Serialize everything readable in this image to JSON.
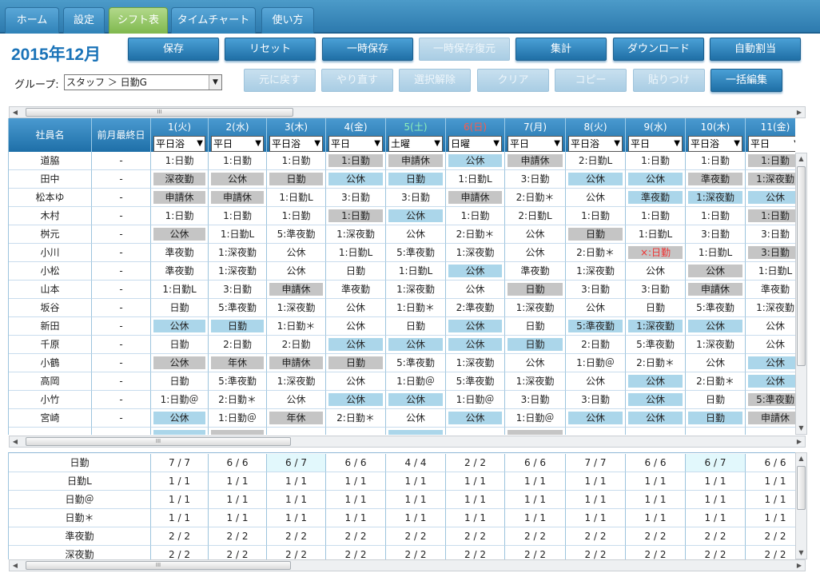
{
  "tabs": [
    {
      "label": "ホーム"
    },
    {
      "label": "設定"
    },
    {
      "label": "シフト表",
      "active": true
    },
    {
      "label": "タイムチャート"
    },
    {
      "label": "使い方"
    }
  ],
  "month_title": "2015年12月",
  "toolbar_row1": [
    {
      "label": "保存",
      "enabled": true
    },
    {
      "label": "リセット",
      "enabled": true
    },
    {
      "label": "一時保存",
      "enabled": true
    },
    {
      "label": "一時保存復元",
      "enabled": false
    },
    {
      "label": "集計",
      "enabled": true
    },
    {
      "label": "ダウンロード",
      "enabled": true
    },
    {
      "label": "自動割当",
      "enabled": true
    }
  ],
  "toolbar_row2": [
    {
      "label": "元に戻す",
      "enabled": false
    },
    {
      "label": "やり直す",
      "enabled": false
    },
    {
      "label": "選択解除",
      "enabled": false
    },
    {
      "label": "クリア",
      "enabled": false
    },
    {
      "label": "コピー",
      "enabled": false
    },
    {
      "label": "貼りつけ",
      "enabled": false
    },
    {
      "label": "一括編集",
      "enabled": true
    }
  ],
  "group": {
    "label": "グループ:",
    "value": "スタッフ ＞ 日勤G"
  },
  "headers": {
    "name": "社員名",
    "last": "前月最終日"
  },
  "days": [
    {
      "label": "1(火)",
      "sel": "平日浴"
    },
    {
      "label": "2(水)",
      "sel": "平日"
    },
    {
      "label": "3(木)",
      "sel": "平日浴"
    },
    {
      "label": "4(金)",
      "sel": "平日"
    },
    {
      "label": "5(土)",
      "sel": "土曜",
      "kind": "sat"
    },
    {
      "label": "6(日)",
      "sel": "日曜",
      "kind": "sun"
    },
    {
      "label": "7(月)",
      "sel": "平日"
    },
    {
      "label": "8(火)",
      "sel": "平日浴"
    },
    {
      "label": "9(水)",
      "sel": "平日"
    },
    {
      "label": "10(木)",
      "sel": "平日浴"
    },
    {
      "label": "11(金)",
      "sel": "平日"
    }
  ],
  "colors": {
    "blue": "#abd6ea",
    "gray": "#c5c5c5",
    "accent": "#1a73b8"
  },
  "staff": [
    {
      "name": "道脇",
      "last": "-",
      "cells": [
        [
          "1:日勤",
          ""
        ],
        [
          "1:日勤",
          ""
        ],
        [
          "1:日勤",
          ""
        ],
        [
          "1:日勤",
          "g"
        ],
        [
          "申請休",
          "g"
        ],
        [
          "公休",
          "b"
        ],
        [
          "申請休",
          "g"
        ],
        [
          "2:日勤L",
          ""
        ],
        [
          "1:日勤",
          ""
        ],
        [
          "1:日勤",
          ""
        ],
        [
          "1:日勤",
          "g"
        ]
      ]
    },
    {
      "name": "田中",
      "last": "-",
      "cells": [
        [
          "深夜勤",
          "g"
        ],
        [
          "公休",
          "g"
        ],
        [
          "日勤",
          "g"
        ],
        [
          "公休",
          "b"
        ],
        [
          "日勤",
          "b"
        ],
        [
          "1:日勤L",
          ""
        ],
        [
          "3:日勤",
          ""
        ],
        [
          "公休",
          "b"
        ],
        [
          "公休",
          "b"
        ],
        [
          "準夜勤",
          "g"
        ],
        [
          "1:深夜勤",
          "g"
        ]
      ]
    },
    {
      "name": "松本ゆ",
      "last": "-",
      "cells": [
        [
          "申請休",
          "g"
        ],
        [
          "申請休",
          "g"
        ],
        [
          "1:日勤L",
          ""
        ],
        [
          "3:日勤",
          ""
        ],
        [
          "3:日勤",
          ""
        ],
        [
          "申請休",
          "g"
        ],
        [
          "2:日勤＊",
          ""
        ],
        [
          "公休",
          ""
        ],
        [
          "準夜勤",
          "b"
        ],
        [
          "1:深夜勤",
          "b"
        ],
        [
          "公休",
          "b"
        ]
      ]
    },
    {
      "name": "木村",
      "last": "-",
      "cells": [
        [
          "1:日勤",
          ""
        ],
        [
          "1:日勤",
          ""
        ],
        [
          "1:日勤",
          ""
        ],
        [
          "1:日勤",
          "g"
        ],
        [
          "公休",
          "b"
        ],
        [
          "1:日勤",
          ""
        ],
        [
          "2:日勤L",
          ""
        ],
        [
          "1:日勤",
          ""
        ],
        [
          "1:日勤",
          ""
        ],
        [
          "1:日勤",
          ""
        ],
        [
          "1:日勤",
          "g"
        ]
      ]
    },
    {
      "name": "桝元",
      "last": "-",
      "cells": [
        [
          "公休",
          "g"
        ],
        [
          "1:日勤L",
          ""
        ],
        [
          "5:準夜勤",
          ""
        ],
        [
          "1:深夜勤",
          ""
        ],
        [
          "公休",
          ""
        ],
        [
          "2:日勤＊",
          ""
        ],
        [
          "公休",
          ""
        ],
        [
          "日勤",
          "g"
        ],
        [
          "1:日勤L",
          ""
        ],
        [
          "3:日勤",
          ""
        ],
        [
          "3:日勤",
          ""
        ]
      ]
    },
    {
      "name": "小川",
      "last": "-",
      "cells": [
        [
          "準夜勤",
          ""
        ],
        [
          "1:深夜勤",
          ""
        ],
        [
          "公休",
          ""
        ],
        [
          "1:日勤L",
          ""
        ],
        [
          "5:準夜勤",
          ""
        ],
        [
          "1:深夜勤",
          ""
        ],
        [
          "公休",
          ""
        ],
        [
          "2:日勤＊",
          ""
        ],
        [
          "×:日勤",
          "g",
          "red"
        ],
        [
          "1:日勤L",
          ""
        ],
        [
          "3:日勤",
          "g"
        ]
      ]
    },
    {
      "name": "小松",
      "last": "-",
      "cells": [
        [
          "準夜勤",
          ""
        ],
        [
          "1:深夜勤",
          ""
        ],
        [
          "公休",
          ""
        ],
        [
          "日勤",
          ""
        ],
        [
          "1:日勤L",
          ""
        ],
        [
          "公休",
          "b"
        ],
        [
          "準夜勤",
          ""
        ],
        [
          "1:深夜勤",
          ""
        ],
        [
          "公休",
          ""
        ],
        [
          "公休",
          "g"
        ],
        [
          "1:日勤L",
          ""
        ]
      ]
    },
    {
      "name": "山本",
      "last": "-",
      "cells": [
        [
          "1:日勤L",
          ""
        ],
        [
          "3:日勤",
          ""
        ],
        [
          "申請休",
          "g"
        ],
        [
          "準夜勤",
          ""
        ],
        [
          "1:深夜勤",
          ""
        ],
        [
          "公休",
          ""
        ],
        [
          "日勤",
          "g"
        ],
        [
          "3:日勤",
          ""
        ],
        [
          "3:日勤",
          ""
        ],
        [
          "申請休",
          "g"
        ],
        [
          "準夜勤",
          ""
        ]
      ]
    },
    {
      "name": "坂谷",
      "last": "-",
      "cells": [
        [
          "日勤",
          ""
        ],
        [
          "5:準夜勤",
          ""
        ],
        [
          "1:深夜勤",
          ""
        ],
        [
          "公休",
          ""
        ],
        [
          "1:日勤＊",
          ""
        ],
        [
          "2:準夜勤",
          ""
        ],
        [
          "1:深夜勤",
          ""
        ],
        [
          "公休",
          ""
        ],
        [
          "日勤",
          ""
        ],
        [
          "5:準夜勤",
          ""
        ],
        [
          "1:深夜勤",
          ""
        ]
      ]
    },
    {
      "name": "新田",
      "last": "-",
      "cells": [
        [
          "公休",
          "b"
        ],
        [
          "日勤",
          "b"
        ],
        [
          "1:日勤＊",
          ""
        ],
        [
          "公休",
          ""
        ],
        [
          "日勤",
          ""
        ],
        [
          "公休",
          "b"
        ],
        [
          "日勤",
          ""
        ],
        [
          "5:準夜勤",
          "b"
        ],
        [
          "1:深夜勤",
          "b"
        ],
        [
          "公休",
          "b"
        ],
        [
          "公休",
          ""
        ]
      ]
    },
    {
      "name": "千原",
      "last": "-",
      "cells": [
        [
          "日勤",
          ""
        ],
        [
          "2:日勤",
          ""
        ],
        [
          "2:日勤",
          ""
        ],
        [
          "公休",
          "b"
        ],
        [
          "公休",
          "b"
        ],
        [
          "公休",
          "b"
        ],
        [
          "日勤",
          "b"
        ],
        [
          "2:日勤",
          ""
        ],
        [
          "5:準夜勤",
          ""
        ],
        [
          "1:深夜勤",
          ""
        ],
        [
          "公休",
          ""
        ]
      ]
    },
    {
      "name": "小鶴",
      "last": "-",
      "cells": [
        [
          "公休",
          "g"
        ],
        [
          "年休",
          "g"
        ],
        [
          "申請休",
          "g"
        ],
        [
          "日勤",
          "g"
        ],
        [
          "5:準夜勤",
          ""
        ],
        [
          "1:深夜勤",
          ""
        ],
        [
          "公休",
          ""
        ],
        [
          "1:日勤＠",
          ""
        ],
        [
          "2:日勤＊",
          ""
        ],
        [
          "公休",
          ""
        ],
        [
          "公休",
          "b"
        ]
      ]
    },
    {
      "name": "高岡",
      "last": "-",
      "cells": [
        [
          "日勤",
          ""
        ],
        [
          "5:準夜勤",
          ""
        ],
        [
          "1:深夜勤",
          ""
        ],
        [
          "公休",
          ""
        ],
        [
          "1:日勤＠",
          ""
        ],
        [
          "5:準夜勤",
          ""
        ],
        [
          "1:深夜勤",
          ""
        ],
        [
          "公休",
          ""
        ],
        [
          "公休",
          "b"
        ],
        [
          "2:日勤＊",
          ""
        ],
        [
          "公休",
          "b"
        ]
      ]
    },
    {
      "name": "小竹",
      "last": "-",
      "cells": [
        [
          "1:日勤＠",
          ""
        ],
        [
          "2:日勤＊",
          ""
        ],
        [
          "公休",
          ""
        ],
        [
          "公休",
          "b"
        ],
        [
          "公休",
          "b"
        ],
        [
          "1:日勤＠",
          ""
        ],
        [
          "3:日勤",
          ""
        ],
        [
          "3:日勤",
          ""
        ],
        [
          "公休",
          "b"
        ],
        [
          "日勤",
          ""
        ],
        [
          "5:準夜勤",
          "g"
        ]
      ]
    },
    {
      "name": "宮崎",
      "last": "-",
      "cells": [
        [
          "公休",
          "b"
        ],
        [
          "1:日勤＠",
          ""
        ],
        [
          "年休",
          "g"
        ],
        [
          "2:日勤＊",
          ""
        ],
        [
          "公休",
          ""
        ],
        [
          "公休",
          "b"
        ],
        [
          "1:日勤＠",
          ""
        ],
        [
          "公休",
          "b"
        ],
        [
          "公休",
          "b"
        ],
        [
          "日勤",
          "b"
        ],
        [
          "申請休",
          "g"
        ]
      ]
    },
    {
      "name": "",
      "last": "",
      "cells": [
        [
          "",
          "b"
        ],
        [
          "",
          "g"
        ],
        [
          "",
          ""
        ],
        [
          "",
          ""
        ],
        [
          "",
          "b"
        ],
        [
          "",
          ""
        ],
        [
          "",
          "g"
        ],
        [
          "",
          ""
        ],
        [
          "",
          ""
        ],
        [
          "",
          ""
        ],
        [
          "",
          ""
        ]
      ]
    }
  ],
  "summary": [
    {
      "label": "日勤",
      "values": [
        "7 / 7",
        "6 / 6",
        "6 / 7",
        "6 / 6",
        "4 / 4",
        "2 / 2",
        "6 / 6",
        "7 / 7",
        "6 / 6",
        "6 / 7",
        "6 / 6"
      ],
      "hl": [
        2,
        9
      ]
    },
    {
      "label": "日勤L",
      "values": [
        "1 / 1",
        "1 / 1",
        "1 / 1",
        "1 / 1",
        "1 / 1",
        "1 / 1",
        "1 / 1",
        "1 / 1",
        "1 / 1",
        "1 / 1",
        "1 / 1"
      ]
    },
    {
      "label": "日勤＠",
      "values": [
        "1 / 1",
        "1 / 1",
        "1 / 1",
        "1 / 1",
        "1 / 1",
        "1 / 1",
        "1 / 1",
        "1 / 1",
        "1 / 1",
        "1 / 1",
        "1 / 1"
      ]
    },
    {
      "label": "日勤＊",
      "values": [
        "1 / 1",
        "1 / 1",
        "1 / 1",
        "1 / 1",
        "1 / 1",
        "1 / 1",
        "1 / 1",
        "1 / 1",
        "1 / 1",
        "1 / 1",
        "1 / 1"
      ]
    },
    {
      "label": "準夜勤",
      "values": [
        "2 / 2",
        "2 / 2",
        "2 / 2",
        "2 / 2",
        "2 / 2",
        "2 / 2",
        "2 / 2",
        "2 / 2",
        "2 / 2",
        "2 / 2",
        "2 / 2"
      ]
    },
    {
      "label": "深夜勤",
      "values": [
        "2 / 2",
        "2 / 2",
        "2 / 2",
        "2 / 2",
        "2 / 2",
        "2 / 2",
        "2 / 2",
        "2 / 2",
        "2 / 2",
        "2 / 2",
        "2 / 2"
      ]
    }
  ]
}
